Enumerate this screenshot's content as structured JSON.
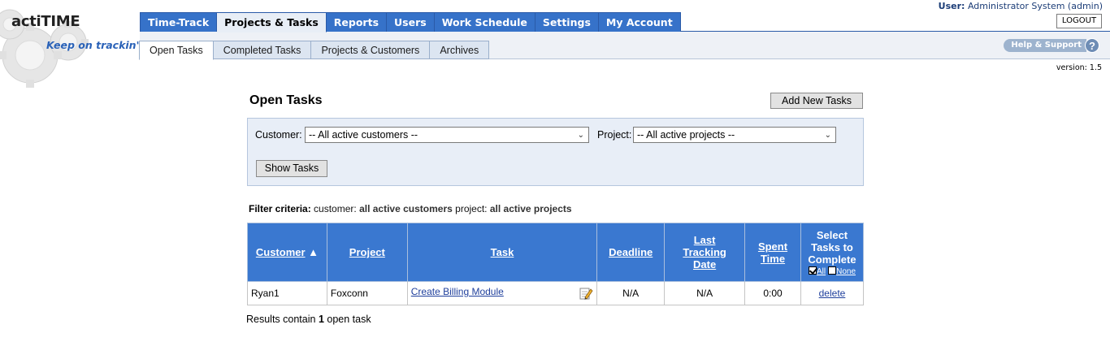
{
  "brand": {
    "logo": "actiTIME",
    "tagline": "Keep on trackin'"
  },
  "colors": {
    "nav_blue": "#3672c9",
    "header_blue": "#3a78d0",
    "link_blue": "#1f3f9c",
    "filter_bg": "#e8eef7"
  },
  "user": {
    "label": "User:",
    "name": "Administrator System (admin)",
    "logout_label": "LOGOUT"
  },
  "top_nav": [
    "Time-Track",
    "Projects & Tasks",
    "Reports",
    "Users",
    "Work Schedule",
    "Settings",
    "My Account"
  ],
  "top_nav_active": "Projects & Tasks",
  "sub_nav": [
    "Open Tasks",
    "Completed Tasks",
    "Projects & Customers",
    "Archives"
  ],
  "sub_nav_active": "Open Tasks",
  "help_label": "Help & Support",
  "help_icon": "question-icon",
  "version": "version: 1.5",
  "page": {
    "title": "Open Tasks",
    "add_button": "Add New Tasks"
  },
  "filter": {
    "customer_label": "Customer:",
    "customer_value": "-- All active customers --",
    "project_label": "Project:",
    "project_value": "-- All active projects --",
    "show_button": "Show Tasks"
  },
  "criteria": {
    "label": "Filter criteria:",
    "customer_key": "customer:",
    "customer_val": "all active customers",
    "project_key": "project:",
    "project_val": "all active projects"
  },
  "table": {
    "headers": {
      "customer": "Customer",
      "sort_icon": "▲",
      "project": "Project",
      "task": "Task",
      "deadline": "Deadline",
      "last_tracking_1": "Last",
      "last_tracking_2": "Tracking",
      "last_tracking_3": "Date",
      "spent_1": "Spent",
      "spent_2": "Time",
      "select_1": "Select",
      "select_2": "Tasks to",
      "select_3": "Complete",
      "all": "All",
      "none": "None"
    },
    "rows": [
      {
        "customer": "Ryan1",
        "project": "Foxconn",
        "task": "Create Billing Module",
        "deadline": "N/A",
        "last_tracking": "N/A",
        "spent": "0:00",
        "action": "delete"
      }
    ]
  },
  "results": {
    "prefix": "Results contain ",
    "count": "1",
    "suffix": " open task"
  }
}
